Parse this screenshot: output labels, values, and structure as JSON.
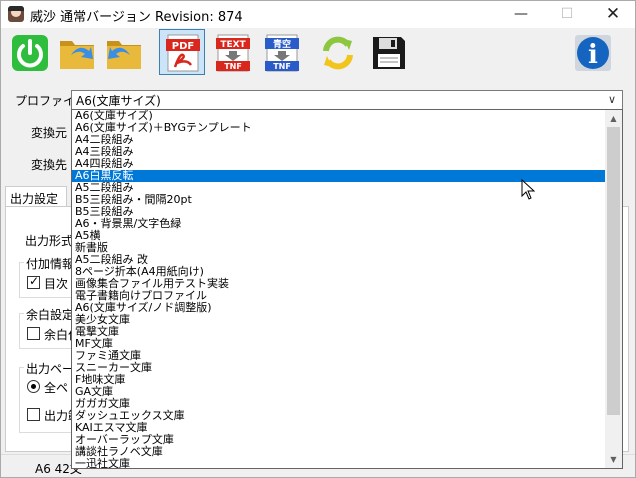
{
  "window": {
    "title": "威沙 通常バージョン Revision: 874",
    "minimize": "—",
    "maximize": "☐",
    "close": "✕"
  },
  "toolbar": {
    "buttons": [
      {
        "name": "power-button",
        "icon": "power-icon"
      },
      {
        "name": "open-folder-button",
        "icon": "folder-forward-icon"
      },
      {
        "name": "folder-back-button",
        "icon": "folder-back-icon"
      },
      {
        "name": "pdf-button",
        "icon": "pdf-icon",
        "label": "PDF"
      },
      {
        "name": "text-to-tnf-button",
        "icon": "text-tnf-icon",
        "label_top": "TEXT",
        "label_bottom": "TNF"
      },
      {
        "name": "aozora-to-tnf-button",
        "icon": "aozora-tnf-icon",
        "label_top": "青空",
        "label_bottom": "TNF"
      },
      {
        "name": "refresh-button",
        "icon": "refresh-icon"
      },
      {
        "name": "save-button",
        "icon": "floppy-disk-icon"
      },
      {
        "name": "info-button",
        "icon": "info-icon",
        "label": "i"
      }
    ],
    "colors": {
      "power": "#2ebd3c",
      "pdf": "#d9271e",
      "info": "#1565c0",
      "folder": "#d9a520",
      "refresh": "#8dc63f"
    }
  },
  "form": {
    "profile_label": "プロファイル",
    "profile_value": "A6(文庫サイズ)",
    "source_label": "変換元",
    "dest_label": "変換先",
    "tab_output": "出力設定",
    "output_format_label": "出力形式",
    "extra_info_group": "付加情報",
    "toc_checkbox": "目次・",
    "margin_group": "余白設定",
    "margin_checkbox": "余白付",
    "output_page_group": "出力ペー",
    "all_pages_radio": "全ペ",
    "output_range_checkbox": "出力範",
    "status_text": "A6 42文"
  },
  "dropdown": {
    "selected_index": 5,
    "items": [
      "A6(文庫サイズ)",
      "A6(文庫サイズ)＋BYGテンプレート",
      "A4二段組み",
      "A4三段組み",
      "A4四段組み",
      "A6白黒反転",
      "A5二段組み",
      "B5三段組み・間隔20pt",
      "B5三段組み",
      "A6・背景黒/文字色緑",
      "A5横",
      "新書版",
      "A5二段組み 改",
      "8ページ折本(A4用紙向け)",
      "画像集合ファイル用テスト実装",
      "電子書籍向けプロファイル",
      "A6(文庫サイズ/ノド調整版)",
      "美少女文庫",
      "電撃文庫",
      "MF文庫",
      "ファミ通文庫",
      "スニーカー文庫",
      "F地味文庫",
      "GA文庫",
      "ガガガ文庫",
      "ダッシュエックス文庫",
      "KAIエスマ文庫",
      "オーバーラップ文庫",
      "講談社ラノベ文庫",
      "一迅社文庫"
    ],
    "scroll_up": "▲",
    "scroll_down": "▼"
  }
}
